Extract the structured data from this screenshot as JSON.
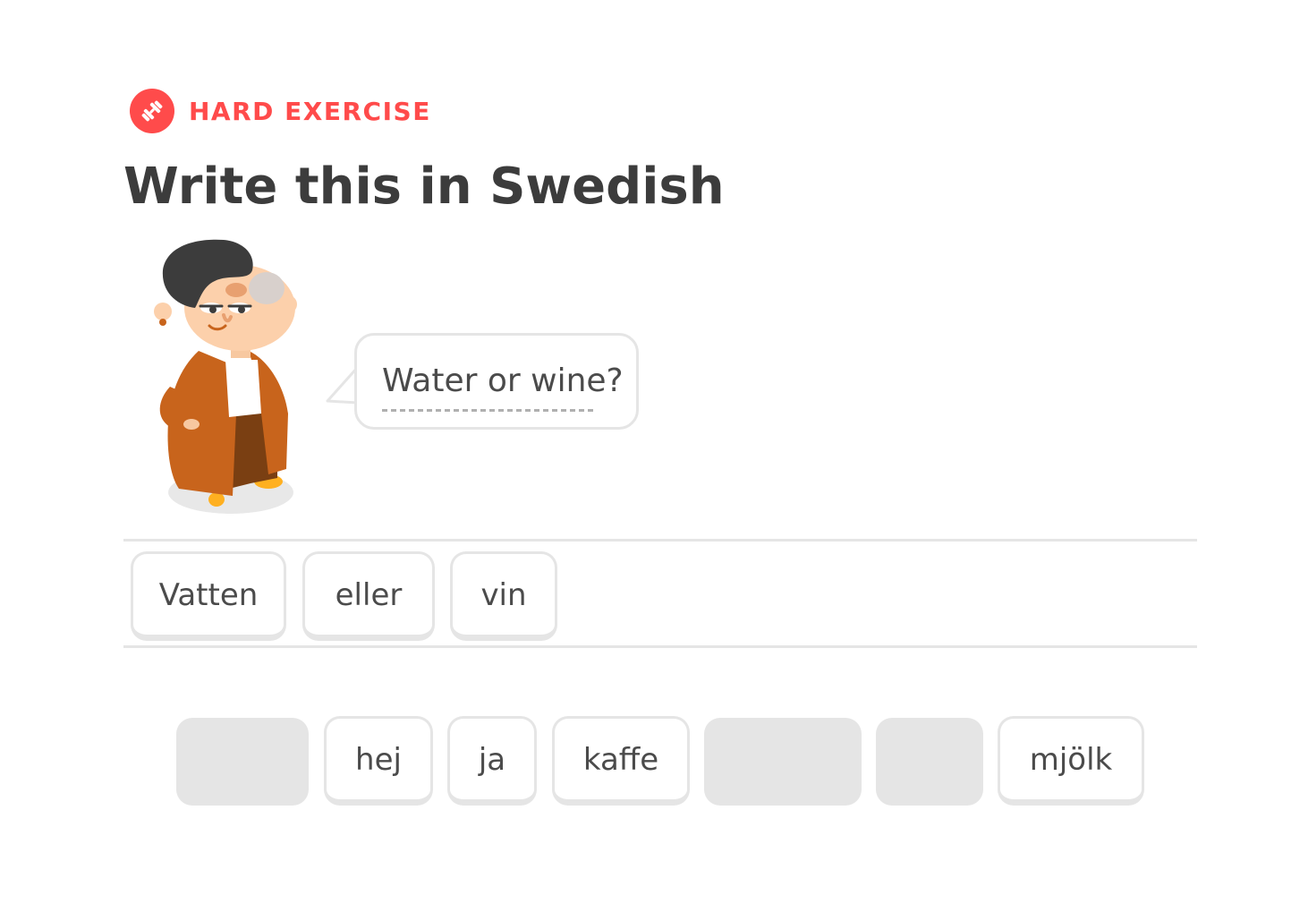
{
  "header": {
    "badge_label": "HARD EXERCISE",
    "badge_icon": "dumbbell-icon",
    "title": "Write this in Swedish"
  },
  "prompt": {
    "text": "Water or wine?"
  },
  "answer": {
    "words": [
      "Vatten",
      "eller",
      "vin"
    ]
  },
  "word_bank": {
    "words": [
      {
        "label": "",
        "used": true
      },
      {
        "label": "hej",
        "used": false
      },
      {
        "label": "ja",
        "used": false
      },
      {
        "label": "kaffe",
        "used": false
      },
      {
        "label": "",
        "used": true
      },
      {
        "label": "",
        "used": true
      },
      {
        "label": "mjölk",
        "used": false
      }
    ]
  },
  "colors": {
    "accent": "#ff4b4b",
    "text": "#3c3c3c",
    "border": "#e5e5e5"
  }
}
